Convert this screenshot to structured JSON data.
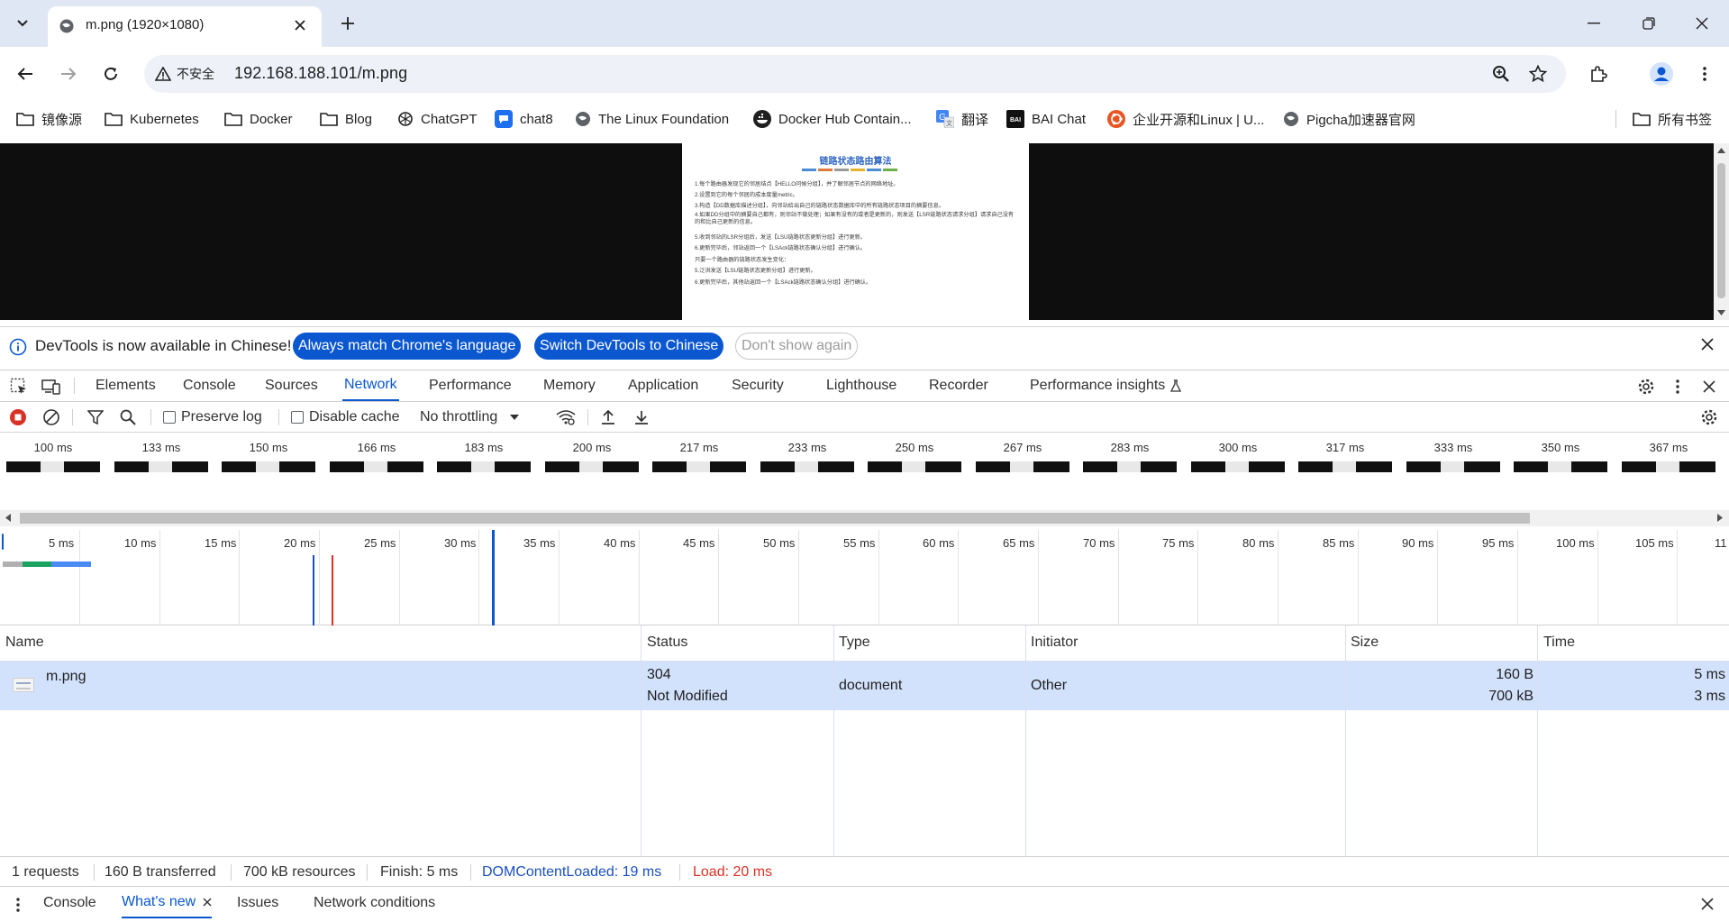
{
  "browser": {
    "tab_title": "m.png (1920×1080)",
    "security_label": "不安全",
    "url": "192.168.188.101/m.png"
  },
  "bookmarks": [
    {
      "label": "镜像源",
      "icon": "folder-icon"
    },
    {
      "label": "Kubernetes",
      "icon": "folder-icon"
    },
    {
      "label": "Docker",
      "icon": "folder-icon"
    },
    {
      "label": "Blog",
      "icon": "folder-icon"
    },
    {
      "label": "ChatGPT",
      "icon": "openai-icon"
    },
    {
      "label": "chat8",
      "icon": "chat-icon"
    },
    {
      "label": "The Linux Foundation",
      "icon": "globe-icon"
    },
    {
      "label": "Docker Hub Contain...",
      "icon": "docker-icon"
    },
    {
      "label": "翻译",
      "icon": "translate-icon"
    },
    {
      "label": "BAI Chat",
      "icon": "bai-icon"
    },
    {
      "label": "企业开源和Linux | U...",
      "icon": "ubuntu-icon"
    },
    {
      "label": "Pigcha加速器官网",
      "icon": "globe-icon"
    },
    {
      "label": "所有书签",
      "icon": "folder-icon"
    }
  ],
  "page_image": {
    "title": "链路状态路由算法",
    "lines": [
      "1.每个路由器发现它的邻居结点【HELLO问候分组】，并了解邻居节点的网络地址。",
      "2.设置到它的每个邻居的成本度量metric。",
      "3.构造【DD数据库描述分组】，向邻站给出自己的链路状态数据库中的所有链路状态项目的摘要信息。",
      "4.如果DD分组中的摘要自己都有，则邻站不做处理；如果有没有的或者是更新的，则发送【LSR链路状态请求分组】请求自己没有的和比自己更新的信息。",
      "5.收到邻站的LSR分组后，发送【LSU链路状态更新分组】进行更新。",
      "6.更新完毕后，邻站返回一个【LSAck链路状态确认分组】进行确认。",
      "只要一个路由器的链路状态发生变化：",
      "5.泛洪发送【LSU链路状态更新分组】进行更新。",
      "6.更新完毕后，其他站返回一个【LSAck链路状态确认分组】进行确认。"
    ]
  },
  "devtools": {
    "infobar": {
      "message": "DevTools is now available in Chinese!",
      "btn_match": "Always match Chrome's language",
      "btn_switch": "Switch DevTools to Chinese",
      "btn_dismiss": "Don't show again"
    },
    "tabs": [
      "Elements",
      "Console",
      "Sources",
      "Network",
      "Performance",
      "Memory",
      "Application",
      "Security",
      "Lighthouse",
      "Recorder",
      "Performance insights"
    ],
    "active_tab": "Network",
    "network_toolbar": {
      "preserve_log": "Preserve log",
      "disable_cache": "Disable cache",
      "throttling": "No throttling"
    },
    "filmstrip": [
      "100 ms",
      "133 ms",
      "150 ms",
      "166 ms",
      "183 ms",
      "200 ms",
      "217 ms",
      "233 ms",
      "250 ms",
      "267 ms",
      "283 ms",
      "300 ms",
      "317 ms",
      "333 ms",
      "350 ms",
      "367 ms"
    ],
    "overview_ticks": [
      "5 ms",
      "10 ms",
      "15 ms",
      "20 ms",
      "25 ms",
      "30 ms",
      "35 ms",
      "40 ms",
      "45 ms",
      "50 ms",
      "55 ms",
      "60 ms",
      "65 ms",
      "70 ms",
      "75 ms",
      "80 ms",
      "85 ms",
      "90 ms",
      "95 ms",
      "100 ms",
      "105 ms",
      "11"
    ],
    "table": {
      "headers": {
        "name": "Name",
        "status": "Status",
        "type": "Type",
        "initiator": "Initiator",
        "size": "Size",
        "time": "Time"
      },
      "rows": [
        {
          "name": "m.png",
          "status_code": "304",
          "status_text": "Not Modified",
          "type": "document",
          "initiator": "Other",
          "size_transferred": "160 B",
          "size_resource": "700 kB",
          "time_total": "5 ms",
          "time_latency": "3 ms"
        }
      ]
    },
    "summary": {
      "requests": "1 requests",
      "transferred": "160 B transferred",
      "resources": "700 kB resources",
      "finish": "Finish: 5 ms",
      "dcl": "DOMContentLoaded: 19 ms",
      "load": "Load: 20 ms"
    },
    "drawer_tabs": [
      "Console",
      "What's new",
      "Issues",
      "Network conditions"
    ],
    "drawer_active": "What's new"
  },
  "colors": {
    "accent": "#0b57d0",
    "dcl_blue": "#1a4fc4",
    "load_red": "#d93025",
    "selected_row": "#d3e2fc"
  }
}
